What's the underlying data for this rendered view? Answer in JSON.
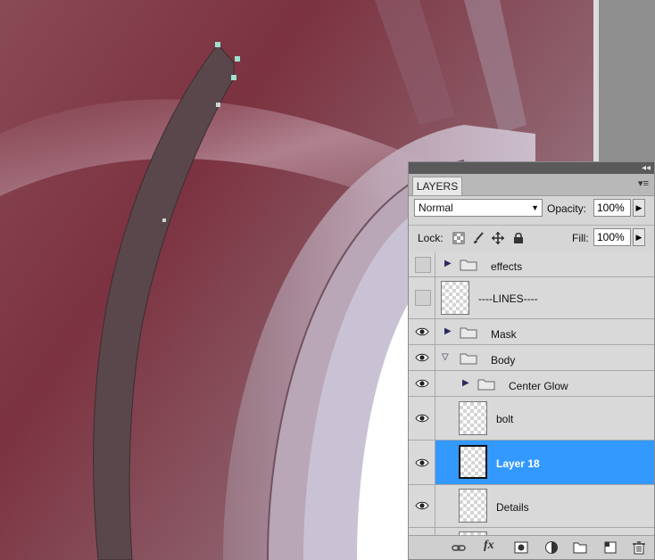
{
  "panel": {
    "collapse_glyph": "◂◂",
    "tab_label": "LAYERS",
    "menu_glyph": "▾≡",
    "blend_mode": "Normal",
    "opacity_label": "Opacity:",
    "opacity_value": "100%",
    "lock_label": "Lock:",
    "fill_label": "Fill:",
    "fill_value": "100%"
  },
  "layers": [
    {
      "name": "effects",
      "kind": "group",
      "visible": false,
      "expanded": false,
      "indent": 0
    },
    {
      "name": "----LINES----",
      "kind": "layer",
      "visible": false,
      "indent": 0
    },
    {
      "name": "Mask",
      "kind": "group",
      "visible": true,
      "expanded": false,
      "indent": 0
    },
    {
      "name": "Body",
      "kind": "group",
      "visible": true,
      "expanded": true,
      "indent": 0
    },
    {
      "name": "Center Glow",
      "kind": "group",
      "visible": true,
      "expanded": false,
      "indent": 1
    },
    {
      "name": "bolt",
      "kind": "layer",
      "visible": true,
      "indent": 1
    },
    {
      "name": "Layer 18",
      "kind": "layer",
      "visible": true,
      "indent": 1,
      "selected": true
    },
    {
      "name": "Details",
      "kind": "layer",
      "visible": true,
      "indent": 1
    }
  ],
  "bottom_icons": [
    "link-icon",
    "fx-icon",
    "mask-icon",
    "adjustment-icon",
    "folder-icon",
    "new-layer-icon",
    "trash-icon"
  ],
  "bottom_fx_label": "fx",
  "colors": {
    "selection": "#3399ff",
    "canvas_maroon": "#7a3a46",
    "shape_fill": "#5a474c",
    "anchor": "#9fe0cf"
  }
}
